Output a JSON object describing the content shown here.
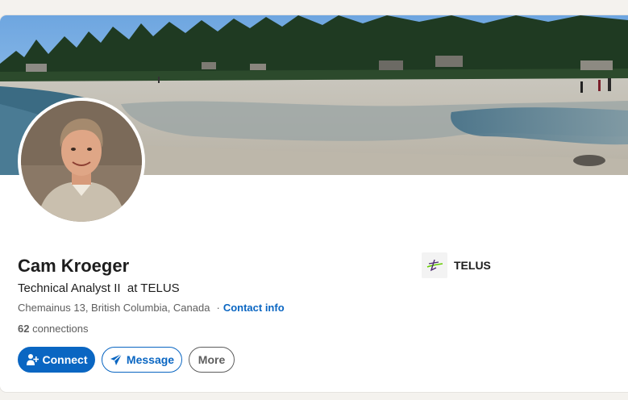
{
  "profile": {
    "name": "Cam Kroeger",
    "headline": "Technical Analyst II  at TELUS",
    "location": "Chemainus 13, British Columbia, Canada",
    "location_separator": "·",
    "contact_info_label": "Contact info",
    "connections_count": "62",
    "connections_label": "connections"
  },
  "actions": {
    "connect_label": "Connect",
    "message_label": "Message",
    "more_label": "More"
  },
  "company": {
    "name": "TELUS",
    "logo_icon": "telus-logo",
    "logo_color": "#4b286d",
    "logo_accent": "#66cc00"
  },
  "banner": {
    "icon": "beach-landscape-photo"
  },
  "colors": {
    "primary": "#0a66c2",
    "text": "#1d1d1d",
    "muted": "#5e5e5e",
    "page_background": "#f4f2ee"
  }
}
